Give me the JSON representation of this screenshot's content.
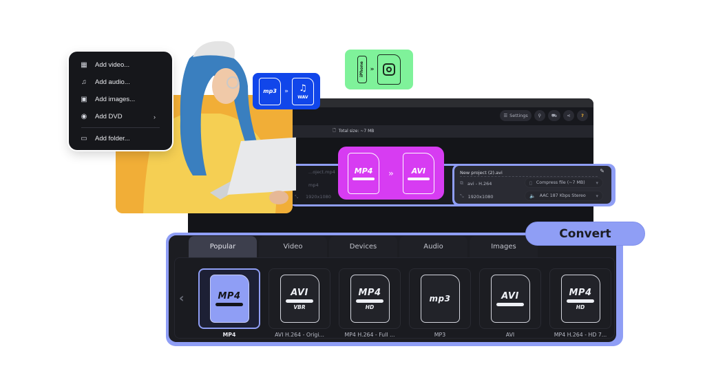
{
  "add_menu": {
    "items": [
      {
        "icon": "video-file-icon",
        "glyph": "▦",
        "label": "Add video..."
      },
      {
        "icon": "music-note-icon",
        "glyph": "♫",
        "label": "Add audio..."
      },
      {
        "icon": "image-add-icon",
        "glyph": "▣",
        "label": "Add images..."
      },
      {
        "icon": "dvd-icon",
        "glyph": "◉",
        "label": "Add DVD",
        "submenu": "›"
      },
      {
        "icon": "folder-add-icon",
        "glyph": "▭",
        "label": "Add folder..."
      }
    ]
  },
  "badges": {
    "blue": {
      "from": "mp3",
      "to": "WAV",
      "arrow": "»",
      "color": "#1146ea"
    },
    "green": {
      "from": "iPhone",
      "to": "instagram",
      "arrow": "»",
      "color": "#7ff29a"
    },
    "purple": {
      "from": "MP4",
      "to": "AVI",
      "arrow": "»",
      "color": "#d73cf2"
    }
  },
  "toolbar": {
    "settings_label": "Settings",
    "settings_icon": "☰",
    "search_icon": "⚲",
    "cart_icon": "🛒",
    "share_icon": "<",
    "help_icon": "?"
  },
  "infobar": {
    "total_size": "Total size: ~7 MB"
  },
  "source_file": {
    "name": "...oject.mp4",
    "format": "mp4",
    "resolution": "1920x1080"
  },
  "target_file": {
    "name": "New project (2).avi",
    "codec": "avi - H.264",
    "resolution": "1920x1080",
    "compress": "Compress file (~7 MB)",
    "audio": "AAC 187 Kbps Stereo"
  },
  "format_panel": {
    "tabs": [
      "Popular",
      "Video",
      "Devices",
      "Audio",
      "Images"
    ],
    "active_tab": "Popular",
    "prev_arrow": "‹",
    "presets": [
      {
        "main": "MP4",
        "sub": "",
        "label": "MP4",
        "active": true
      },
      {
        "main": "AVI",
        "sub": "VBR",
        "label": "AVI H.264 - Origi...",
        "active": false
      },
      {
        "main": "MP4",
        "sub": "HD",
        "label": "MP4 H.264 - Full ...",
        "active": false
      },
      {
        "main": "mp3",
        "sub": "",
        "label": "MP3",
        "active": false
      },
      {
        "main": "AVI",
        "sub": "",
        "label": "AVI",
        "active": false
      },
      {
        "main": "MP4",
        "sub": "HD",
        "label": "MP4 H.264 - HD 7...",
        "active": false
      }
    ]
  },
  "convert_label": "Convert",
  "colors": {
    "accent": "#8f9ef5",
    "app_bg": "#141519",
    "highlight_yellow": "#f1ae37"
  }
}
